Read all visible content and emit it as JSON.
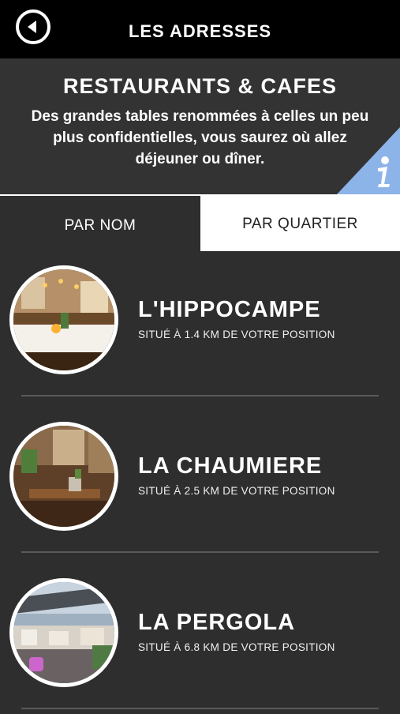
{
  "header": {
    "title": "LES ADRESSES",
    "back_icon": "chevron-left-icon"
  },
  "intro": {
    "title": "RESTAURANTS & CAFES",
    "description": "Des grandes tables renommées à celles un peu plus confidentielles, vous saurez où allez déjeuner ou dîner.",
    "info_icon": "info-icon",
    "info_color": "#8cb4e8"
  },
  "tabs": [
    {
      "label": "PAR NOM",
      "active": false
    },
    {
      "label": "PAR QUARTIER",
      "active": true
    }
  ],
  "restaurants": [
    {
      "name": "L'HIPPOCAMPE",
      "distance": "SITUÉ À 1.4 KM DE VOTRE POSITION"
    },
    {
      "name": "LA CHAUMIERE",
      "distance": "SITUÉ À 2.5 KM DE VOTRE POSITION"
    },
    {
      "name": "LA PERGOLA",
      "distance": "SITUÉ À 6.8 KM DE VOTRE POSITION"
    }
  ]
}
